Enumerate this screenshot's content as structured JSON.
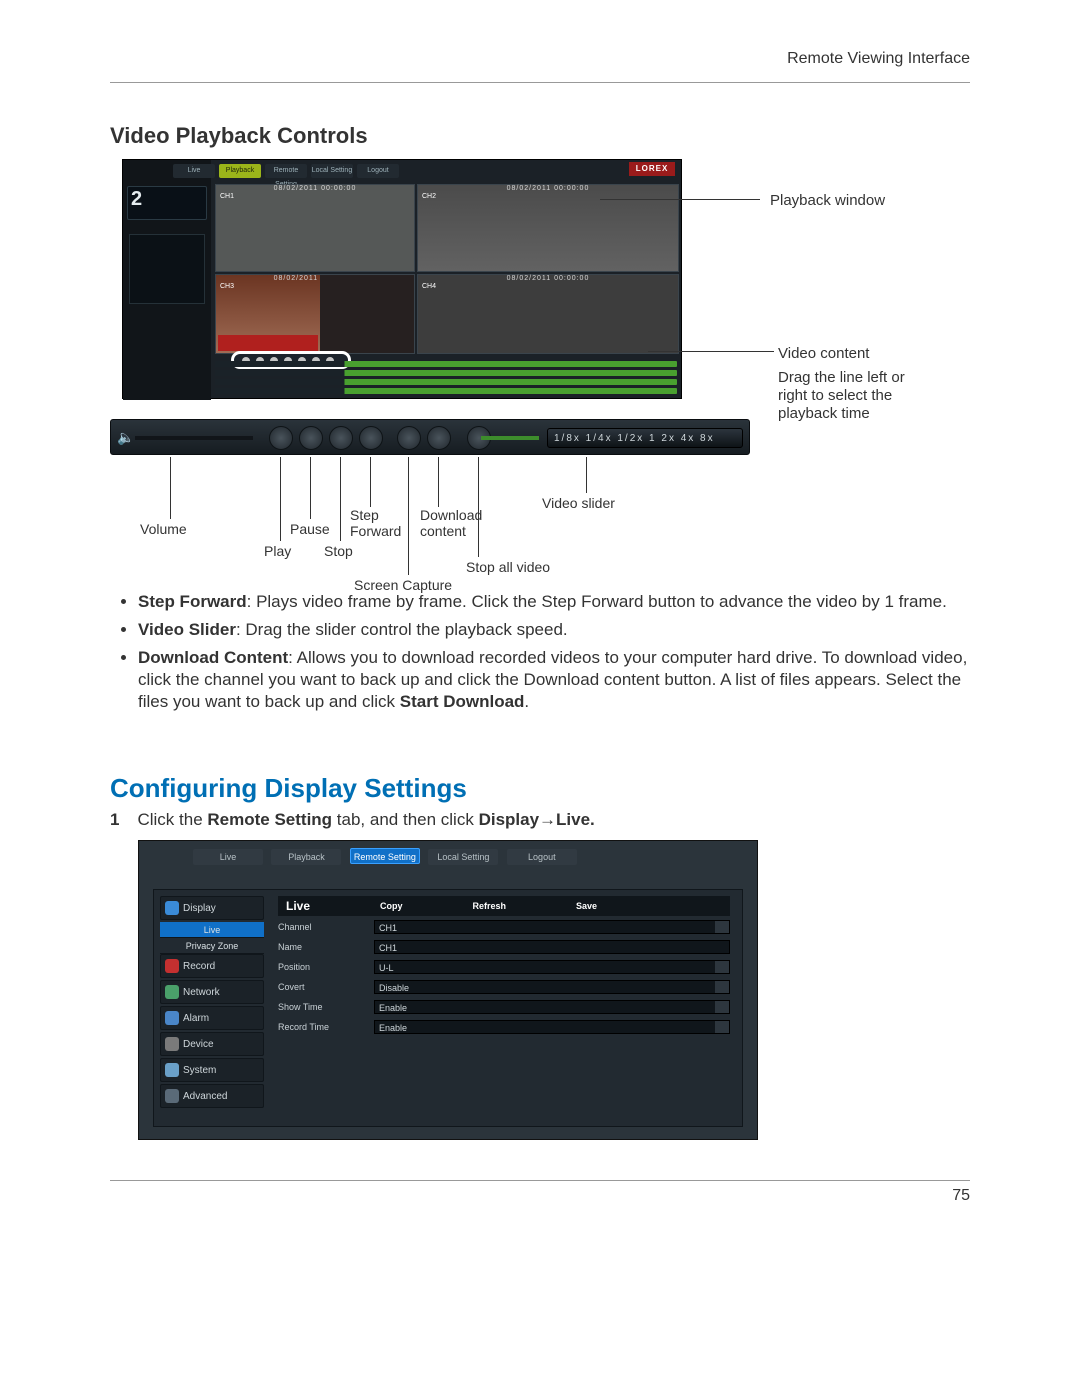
{
  "runningHead": "Remote Viewing Interface",
  "sectionTitle": "Video Playback Controls",
  "pageNumber": "75",
  "playbackShot": {
    "brand": "LOREX",
    "calendarDay": "2",
    "tabs": {
      "live": "Live",
      "playback": "Playback",
      "remote": "Remote Setting",
      "local": "Local Setting",
      "logout": "Logout"
    },
    "timestamp": "08/02/2011  00:00:00",
    "ch": {
      "c1": "CH1",
      "c2": "CH2",
      "c3": "CH3",
      "c4": "CH4"
    },
    "speeds": "1/8x 1/4x 1/2x   1    2x   4x   8x"
  },
  "callouts": {
    "playbackWindow": "Playback window",
    "videoContent": "Video content",
    "dragLine": "Drag the line left or right to select the playback time",
    "volume": "Volume",
    "play": "Play",
    "pause": "Pause",
    "stop": "Stop",
    "stepForward": "Step Forward",
    "screenCapture": "Screen Capture",
    "download": "Download content",
    "stopAll": "Stop all video",
    "videoSlider": "Video slider"
  },
  "bullets": {
    "stepFwdLabel": "Step Forward",
    "stepFwdText": ": Plays video frame by frame. Click the Step Forward button to advance the video by 1 frame.",
    "sliderLabel": "Video Slider",
    "sliderText": ": Drag the slider control the playback speed.",
    "dlLabel": "Download Content",
    "dlText": ": Allows you to download recorded videos to your computer hard drive. To download video, click the channel you want to back up and click the Download content button. A list of files appears. Select the files you want to back up and click ",
    "dlBold": "Start Download",
    "dlTail": "."
  },
  "configHeading": "Configuring Display Settings",
  "step1": {
    "num": "1",
    "pre": "Click the ",
    "b1": "Remote Setting",
    "mid": " tab, and then click ",
    "b2": "Display→Live."
  },
  "remoteShot": {
    "tabs": {
      "live": "Live",
      "playback": "Playback",
      "remote": "Remote Setting",
      "local": "Local Setting",
      "logout": "Logout"
    },
    "nav": {
      "display": "Display",
      "live": "Live",
      "privacy": "Privacy Zone",
      "record": "Record",
      "network": "Network",
      "alarm": "Alarm",
      "device": "Device",
      "system": "System",
      "advanced": "Advanced"
    },
    "panel": {
      "title": "Live",
      "copy": "Copy",
      "refresh": "Refresh",
      "save": "Save",
      "rows": {
        "channel": {
          "l": "Channel",
          "v": "CH1",
          "dd": true
        },
        "name": {
          "l": "Name",
          "v": "CH1",
          "dd": false
        },
        "position": {
          "l": "Position",
          "v": "U-L",
          "dd": true
        },
        "covert": {
          "l": "Covert",
          "v": "Disable",
          "dd": true
        },
        "showTime": {
          "l": "Show Time",
          "v": "Enable",
          "dd": true
        },
        "recordTime": {
          "l": "Record Time",
          "v": "Enable",
          "dd": true
        }
      }
    }
  }
}
